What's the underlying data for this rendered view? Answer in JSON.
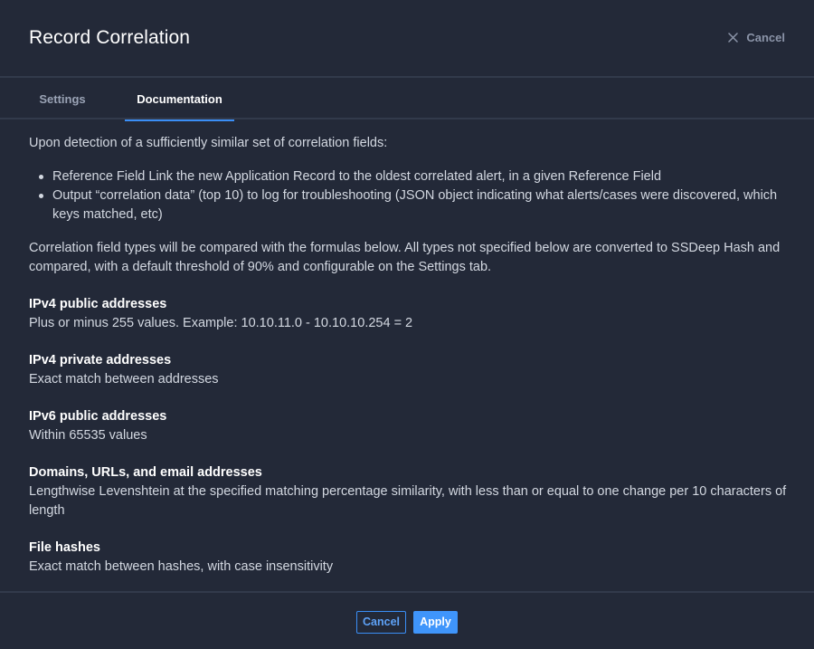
{
  "dialog": {
    "title": "Record Correlation",
    "close_label": "Cancel"
  },
  "tabs": [
    {
      "label": "Settings",
      "active": false
    },
    {
      "label": "Documentation",
      "active": true
    }
  ],
  "doc": {
    "intro": "Upon detection of a sufficiently similar set of correlation fields:",
    "bullets": [
      "Reference Field Link the new Application Record to the oldest correlated alert, in a given Reference Field",
      "Output “correlation data” (top 10) to log for troubleshooting (JSON object indicating what alerts/cases were discovered, which keys matched, etc)"
    ],
    "types_intro": "Correlation field types will be compared with the formulas below. All types not specified below are converted to SSDeep Hash and compared, with a default threshold of 90% and configurable on the Settings tab.",
    "sections": [
      {
        "heading": "IPv4 public addresses",
        "text": "Plus or minus 255 values. Example: 10.10.11.0 - 10.10.10.254 = 2"
      },
      {
        "heading": "IPv4 private addresses",
        "text": "Exact match between addresses"
      },
      {
        "heading": "IPv6 public addresses",
        "text": "Within 65535 values"
      },
      {
        "heading": "Domains, URLs, and email addresses",
        "text": "Lengthwise Levenshtein at the specified matching percentage similarity, with less than or equal to one change per 10 characters of length"
      },
      {
        "heading": "File hashes",
        "text": "Exact match between hashes, with case insensitivity"
      }
    ]
  },
  "footer": {
    "cancel_label": "Cancel",
    "apply_label": "Apply"
  },
  "icons": {
    "close": "close-icon"
  },
  "colors": {
    "background": "#232938",
    "divider": "#323a4b",
    "accent": "#3a8ef6",
    "apply_bg": "#3f95fb",
    "muted_text": "#8b94a8"
  }
}
